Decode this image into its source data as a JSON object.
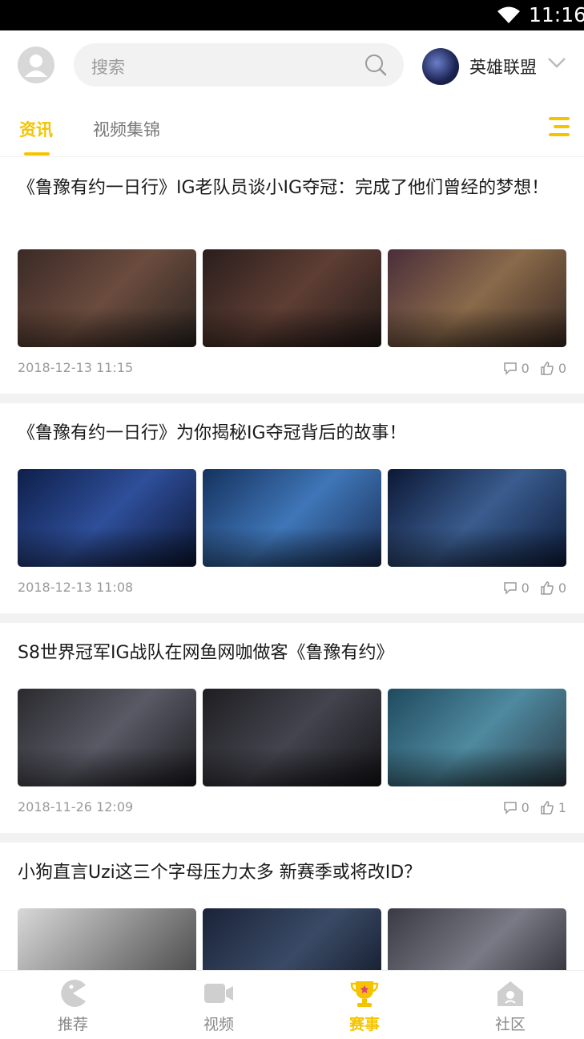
{
  "status_bar": {
    "time": "11:16"
  },
  "header": {
    "search_placeholder": "搜索",
    "game_name": "英雄联盟"
  },
  "tabs": [
    {
      "label": "资讯",
      "active": true
    },
    {
      "label": "视频集锦",
      "active": false
    }
  ],
  "articles": [
    {
      "title": "《鲁豫有约一日行》IG老队员谈小IG夺冠：完成了他们曾经的梦想！",
      "date": "2018-12-13 11:15",
      "comments": "0",
      "likes": "0"
    },
    {
      "title": "《鲁豫有约一日行》为你揭秘IG夺冠背后的故事！",
      "date": "2018-12-13 11:08",
      "comments": "0",
      "likes": "0"
    },
    {
      "title": "S8世界冠军IG战队在网鱼网咖做客《鲁豫有约》",
      "date": "2018-11-26 12:09",
      "comments": "0",
      "likes": "1"
    },
    {
      "title": "小狗直言Uzi这三个字母压力太多 新赛季或将改ID？"
    }
  ],
  "bottom_nav": [
    {
      "label": "推荐",
      "icon": "pacman-icon",
      "active": false
    },
    {
      "label": "视频",
      "icon": "video-camera-icon",
      "active": false
    },
    {
      "label": "赛事",
      "icon": "trophy-icon",
      "active": true
    },
    {
      "label": "社区",
      "icon": "home-icon",
      "active": false
    }
  ],
  "colors": {
    "accent": "#f5c400",
    "muted": "#9a9a9a"
  }
}
